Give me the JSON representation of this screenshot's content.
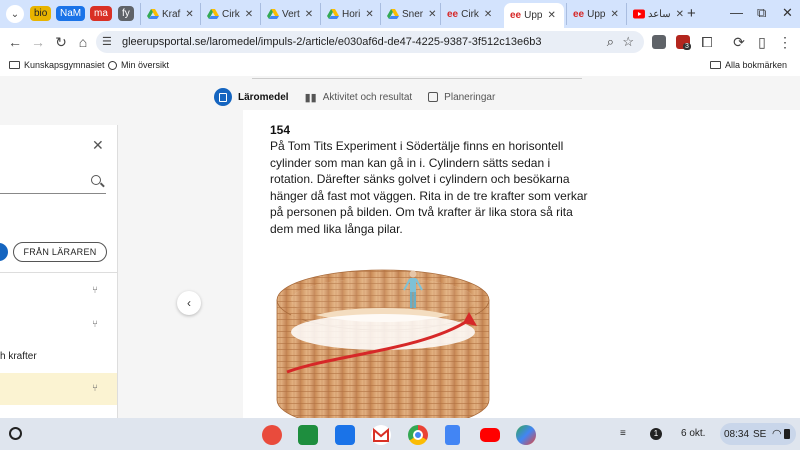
{
  "tab_groups": [
    "bio",
    "NaM",
    "ma",
    "fy"
  ],
  "tabs": [
    {
      "title": "Kraf",
      "favicon": "drive-icon"
    },
    {
      "title": "Cirk",
      "favicon": "drive-icon"
    },
    {
      "title": "Vert",
      "favicon": "drive-icon"
    },
    {
      "title": "Hori",
      "favicon": "drive-icon"
    },
    {
      "title": "Sner",
      "favicon": "drive-icon"
    },
    {
      "title": "Cirk",
      "favicon": "gleerups-icon"
    },
    {
      "title": "Upp",
      "favicon": "gleerups-icon",
      "active": true
    },
    {
      "title": "Upp",
      "favicon": "gleerups-icon"
    },
    {
      "title": "ساعد",
      "favicon": "youtube-icon"
    }
  ],
  "omnibox": {
    "url": "gleerupsportal.se/laromedel/impuls-2/article/e030af6d-de47-4225-9387-3f512c13e6b3"
  },
  "extension_badge": "3",
  "bookmarks": {
    "items": [
      "Kunskapsgymnasiet",
      "Min översikt"
    ],
    "all": "Alla bokmärken"
  },
  "nav": {
    "tabs": [
      "Läromedel",
      "Aktivitet och resultat",
      "Planeringar"
    ]
  },
  "sidepanel": {
    "chip": "FRÅN LÄRAREN",
    "row_label": "h krafter"
  },
  "article": {
    "number": "154",
    "text": "På Tom Tits Experiment i Södertälje finns en horisontell cylinder som man kan gå in i. Cylindern sätts sedan i rotation. Därefter sänks golvet i cylindern och besökarna hänger då fast mot väggen. Rita in de tre krafter som verkar på personen på bilden. Om två krafter är lika stora så rita dem med lika långa pilar."
  },
  "shelf": {
    "notifications": "1",
    "date": "6 okt.",
    "time": "08:34",
    "locale": "SE"
  },
  "colors": {
    "accent": "#1565c0",
    "tab_bar": "#d3e3fd",
    "arrow": "#d62828"
  }
}
